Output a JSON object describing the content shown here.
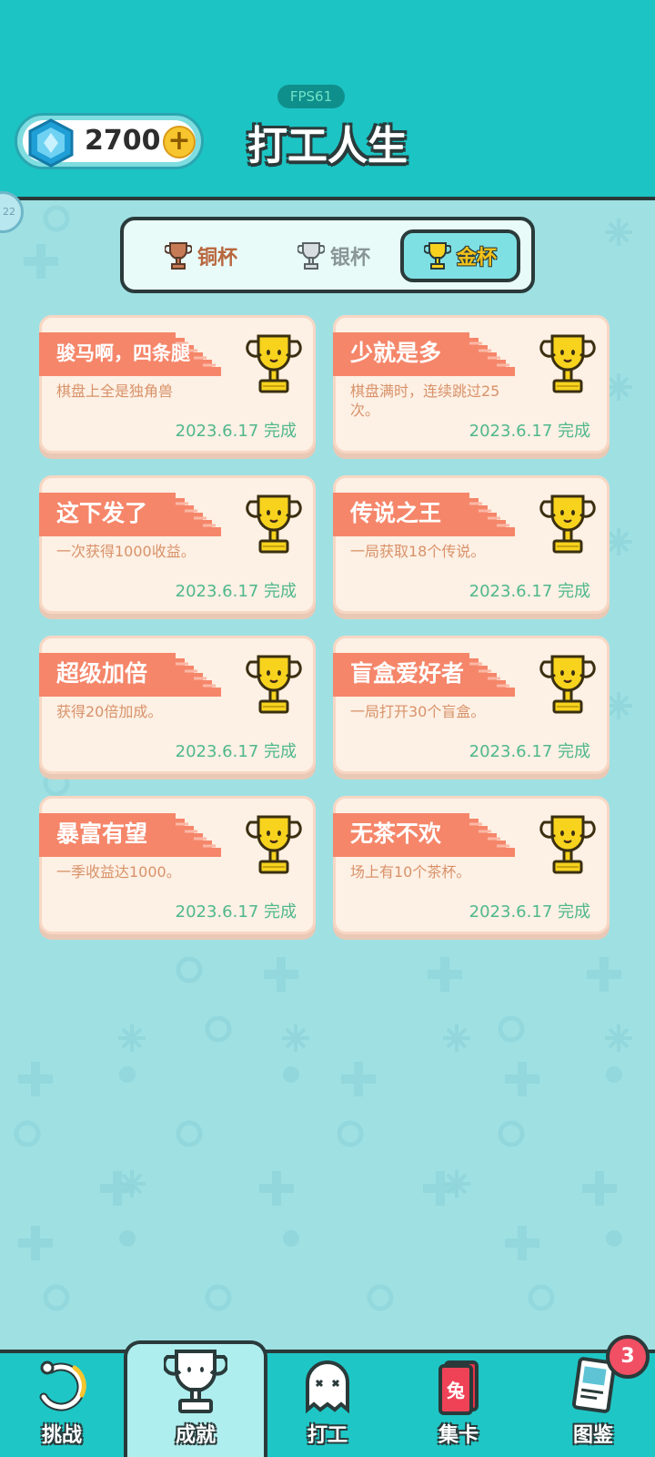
{
  "header": {
    "fps": "FPS61",
    "gems": "2700",
    "title": "打工人生",
    "side_bubble": "22"
  },
  "tabs": [
    {
      "label": "铜杯",
      "icon": "bronze-trophy-icon"
    },
    {
      "label": "银杯",
      "icon": "silver-trophy-icon"
    },
    {
      "label": "金杯",
      "icon": "gold-trophy-icon",
      "selected": true
    }
  ],
  "achievements": [
    {
      "title": "骏马啊，四条腿",
      "desc": "棋盘上全是独角兽",
      "date": "2023.6.17 完成"
    },
    {
      "title": "少就是多",
      "desc": "棋盘满时，连续跳过25次。",
      "date": "2023.6.17 完成"
    },
    {
      "title": "这下发了",
      "desc": "一次获得1000收益。",
      "date": "2023.6.17 完成"
    },
    {
      "title": "传说之王",
      "desc": "一局获取18个传说。",
      "date": "2023.6.17 完成"
    },
    {
      "title": "超级加倍",
      "desc": "获得20倍加成。",
      "date": "2023.6.17 完成"
    },
    {
      "title": "盲盒爱好者",
      "desc": "一局打开30个盲盒。",
      "date": "2023.6.17 完成"
    },
    {
      "title": "暴富有望",
      "desc": "一季收益达1000。",
      "date": "2023.6.17 完成"
    },
    {
      "title": "无茶不欢",
      "desc": "场上有10个茶杯。",
      "date": "2023.6.17 完成"
    }
  ],
  "nav": [
    {
      "label": "挑战",
      "icon": "challenge-icon"
    },
    {
      "label": "成就",
      "icon": "trophy-icon",
      "active": true
    },
    {
      "label": "打工",
      "icon": "ghost-icon"
    },
    {
      "label": "集卡",
      "icon": "card-icon",
      "icon_text": "兔"
    },
    {
      "label": "图鉴",
      "icon": "book-icon"
    }
  ],
  "nav_badge": "3",
  "colors": {
    "header_bg": "#1cc4c4",
    "page_bg": "#9fe0e3",
    "card_bg": "#fdf0e4",
    "ribbon": "#f5866a",
    "date_green": "#4fb88d"
  }
}
